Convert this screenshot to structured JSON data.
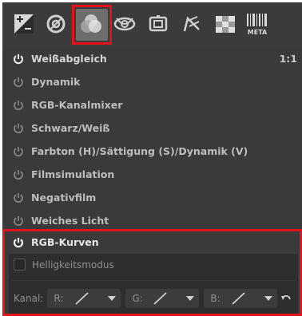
{
  "toolbar": {
    "tabs": [
      {
        "name": "exposure-tab",
        "icon": "exposure-icon"
      },
      {
        "name": "detail-tab",
        "icon": "detail-icon"
      },
      {
        "name": "color-tab",
        "icon": "color-icon",
        "active": true
      },
      {
        "name": "advanced-tab",
        "icon": "advanced-icon"
      },
      {
        "name": "transform-tab",
        "icon": "transform-icon"
      },
      {
        "name": "raw-tab",
        "icon": "raw-icon"
      },
      {
        "name": "filmstrip-tab",
        "icon": "checker-icon"
      },
      {
        "name": "meta-tab",
        "icon": "meta-icon",
        "label": "META"
      }
    ]
  },
  "tools": [
    {
      "label": "Weißabgleich",
      "right": "1:1"
    },
    {
      "label": "Dynamik"
    },
    {
      "label": "RGB-Kanalmixer"
    },
    {
      "label": "Schwarz/Weiß"
    },
    {
      "label": "Farbton (H)/Sättigung (S)/Dynamik (V)"
    },
    {
      "label": "Filmsimulation"
    },
    {
      "label": "Negativfilm"
    },
    {
      "label": "Weiches Licht"
    }
  ],
  "rgb_curves": {
    "title": "RGB-Kurven",
    "luminosity_mode_label": "Helligkeitsmodus",
    "channel_label": "Kanal:",
    "channels": [
      {
        "label": "R:"
      },
      {
        "label": "G:"
      },
      {
        "label": "B:"
      }
    ]
  },
  "colors": {
    "highlight": "#e3121b",
    "panel_bg": "#3a3a3a",
    "text": "#bdbdbd"
  }
}
